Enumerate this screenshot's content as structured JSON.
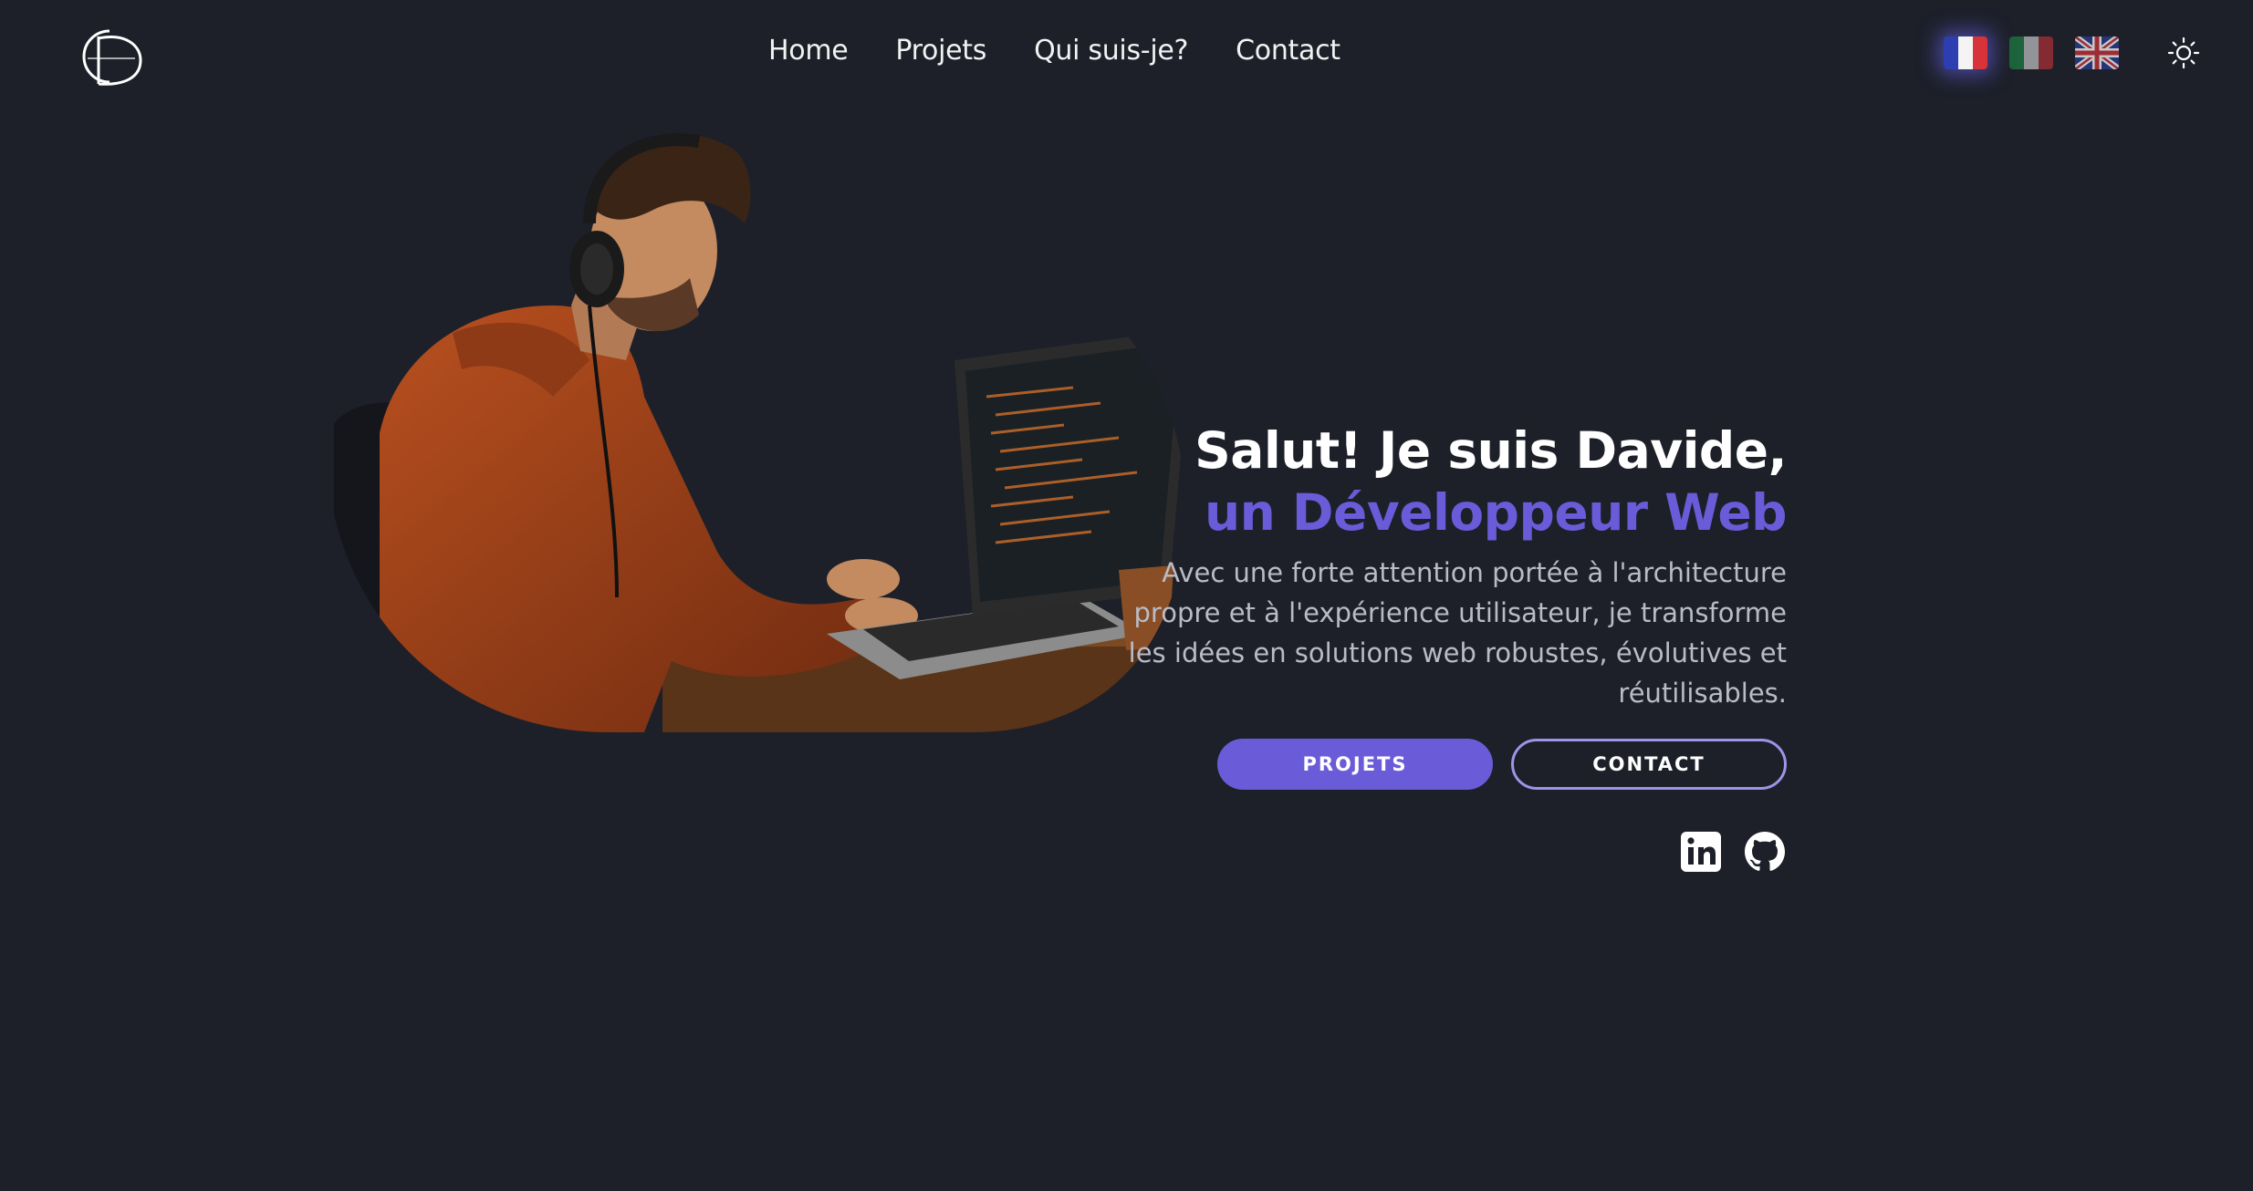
{
  "header": {
    "logo_alt": "CD Developer",
    "nav": [
      {
        "label": "Home"
      },
      {
        "label": "Projets"
      },
      {
        "label": "Qui suis-je?"
      },
      {
        "label": "Contact"
      }
    ],
    "languages": [
      {
        "code": "fr",
        "active": true
      },
      {
        "code": "it",
        "active": false
      },
      {
        "code": "en",
        "active": false
      }
    ],
    "theme_icon": "sun-icon"
  },
  "hero": {
    "title": "Salut! Je suis Davide,",
    "subtitle": "un Développeur Web",
    "description": "Avec une forte attention portée à l'architecture propre et à l'expérience utilisateur, je transforme les idées en solutions web robustes, évolutives et réutilisables.",
    "buttons": {
      "projects": "PROJETS",
      "contact": "CONTACT"
    },
    "socials": [
      "linkedin-icon",
      "github-icon"
    ]
  },
  "colors": {
    "background": "#1d2029",
    "accent": "#6a5bd9",
    "text": "#ffffff",
    "muted": "#b9bcc6"
  }
}
